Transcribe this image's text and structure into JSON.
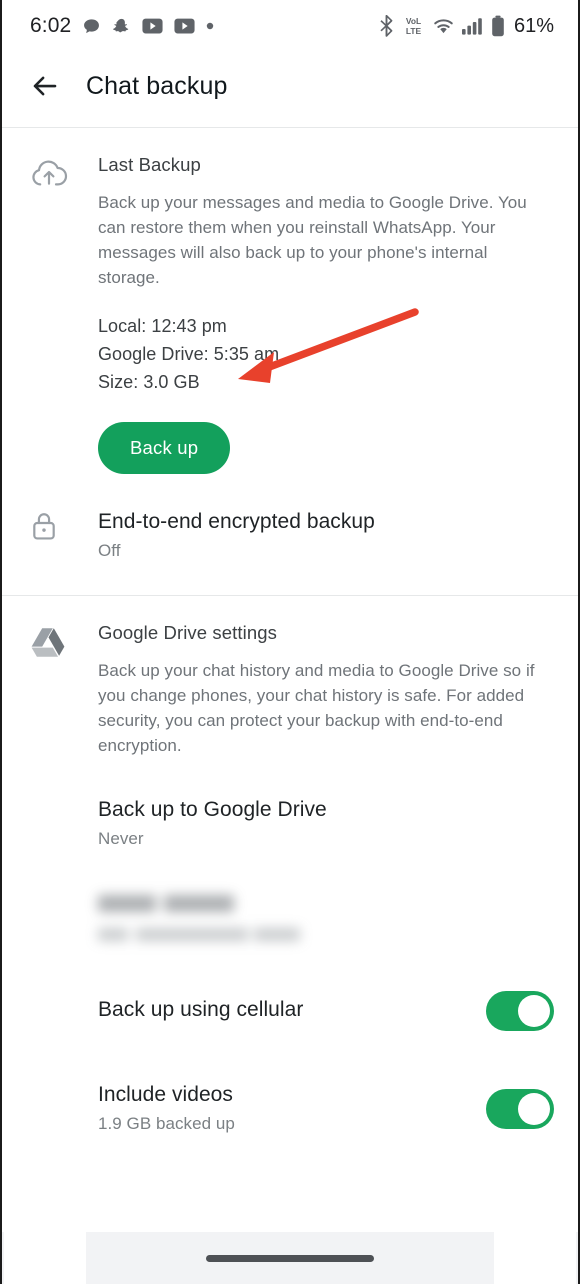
{
  "status_bar": {
    "time": "6:02",
    "left_icons": [
      "chat-bubble-icon",
      "snapchat-icon",
      "youtube-icon",
      "youtube-icon",
      "dot-icon"
    ],
    "right_icons": [
      "bluetooth-icon",
      "volte-icon",
      "wifi-icon",
      "signal-bars-icon",
      "battery-icon"
    ],
    "battery_label": "61%",
    "volte_top": "VoL",
    "volte_bottom": "LTE"
  },
  "app_bar": {
    "back_icon": "arrow-left-icon",
    "title": "Chat backup"
  },
  "last_backup": {
    "icon": "cloud-upload-icon",
    "title": "Last Backup",
    "description": "Back up your messages and media to Google Drive. You can restore them when you reinstall WhatsApp. Your messages will also back up to your phone's internal storage.",
    "details": [
      "Local: 12:43 pm",
      "Google Drive: 5:35 am",
      "Size: 3.0 GB"
    ],
    "button_label": "Back up"
  },
  "encrypted_backup": {
    "icon": "lock-icon",
    "title": "End-to-end encrypted backup",
    "subtitle": "Off"
  },
  "drive_settings": {
    "icon": "google-drive-icon",
    "title": "Google Drive settings",
    "description": "Back up your chat history and media to Google Drive so if you change phones, your chat history is safe. For added security, you can protect your backup with end-to-end encryption."
  },
  "backup_frequency": {
    "title": "Back up to Google Drive",
    "subtitle": "Never"
  },
  "google_account": {
    "title_redacted": true,
    "subtitle_redacted": true
  },
  "cellular": {
    "title": "Back up using cellular",
    "toggle_state": "on"
  },
  "include_videos": {
    "title": "Include videos",
    "subtitle": "1.9 GB backed up",
    "toggle_state": "on"
  },
  "annotation": {
    "type": "arrow",
    "color": "#e8412c",
    "points_to": "Back up"
  },
  "nav_bar": {
    "gesture_pill": "home-gesture-pill"
  },
  "colors": {
    "accent_green": "#13a05c",
    "toggle_green": "#19a75d",
    "annotation_red": "#e8412c",
    "title_text": "#1f2326",
    "secondary_text": "#7b8084"
  }
}
